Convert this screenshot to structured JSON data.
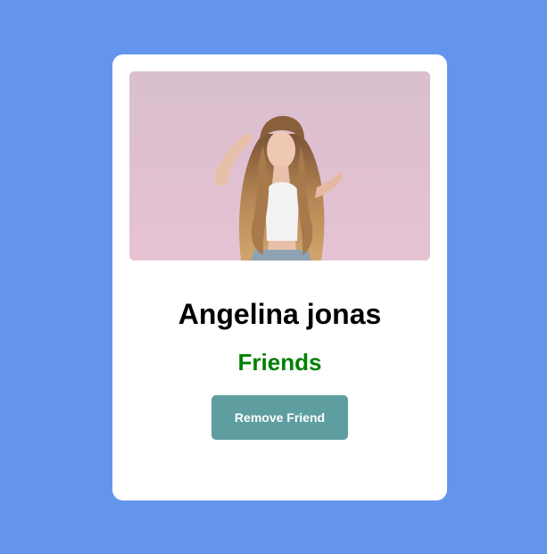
{
  "profile": {
    "name": "Angelina jonas",
    "status": "Friends",
    "photo_alt": "profile-photo"
  },
  "actions": {
    "remove_label": "Remove Friend"
  },
  "colors": {
    "background": "#6495ED",
    "card": "#ffffff",
    "status_text": "#008000",
    "button": "#5F9EA0",
    "button_text": "#ffffff"
  }
}
